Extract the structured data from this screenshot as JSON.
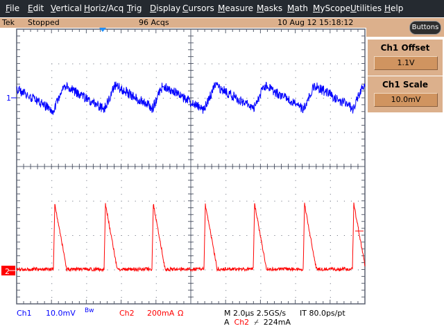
{
  "menu": [
    "File",
    "Edit",
    "Vertical",
    "Horiz/Acq",
    "Trig",
    "Display",
    "Cursors",
    "Measure",
    "Masks",
    "Math",
    "MyScope",
    "Utilities",
    "Help"
  ],
  "status": {
    "brand": "Tek",
    "state": "Stopped",
    "acqs": "96 Acqs",
    "datetime": "10 Aug 12 15:18:12"
  },
  "side": {
    "buttons_label": "Buttons",
    "offset_title": "Ch1 Offset",
    "offset_value": "1.1V",
    "scale_title": "Ch1 Scale",
    "scale_value": "10.0mV"
  },
  "markers": {
    "ch1": "1",
    "ch2": "2"
  },
  "readout": {
    "ch1": "Ch1",
    "ch1_scale": "10.0mV",
    "bw": "Bw",
    "ch2": "Ch2",
    "ch2_scale": "200mA",
    "ch2_coupling": "Ω",
    "horiz": "M 2.0µs 2.5GS/s",
    "resolution": "IT 80.0ps/pt",
    "trig_prefix": "A",
    "trig_source": "Ch2",
    "trig_slope": "⌿",
    "trig_level": "224mA"
  },
  "colors": {
    "ch1": "#0000ff",
    "ch2": "#ff0000",
    "grid": "#5a6070",
    "accent": "#dcb08c"
  }
}
